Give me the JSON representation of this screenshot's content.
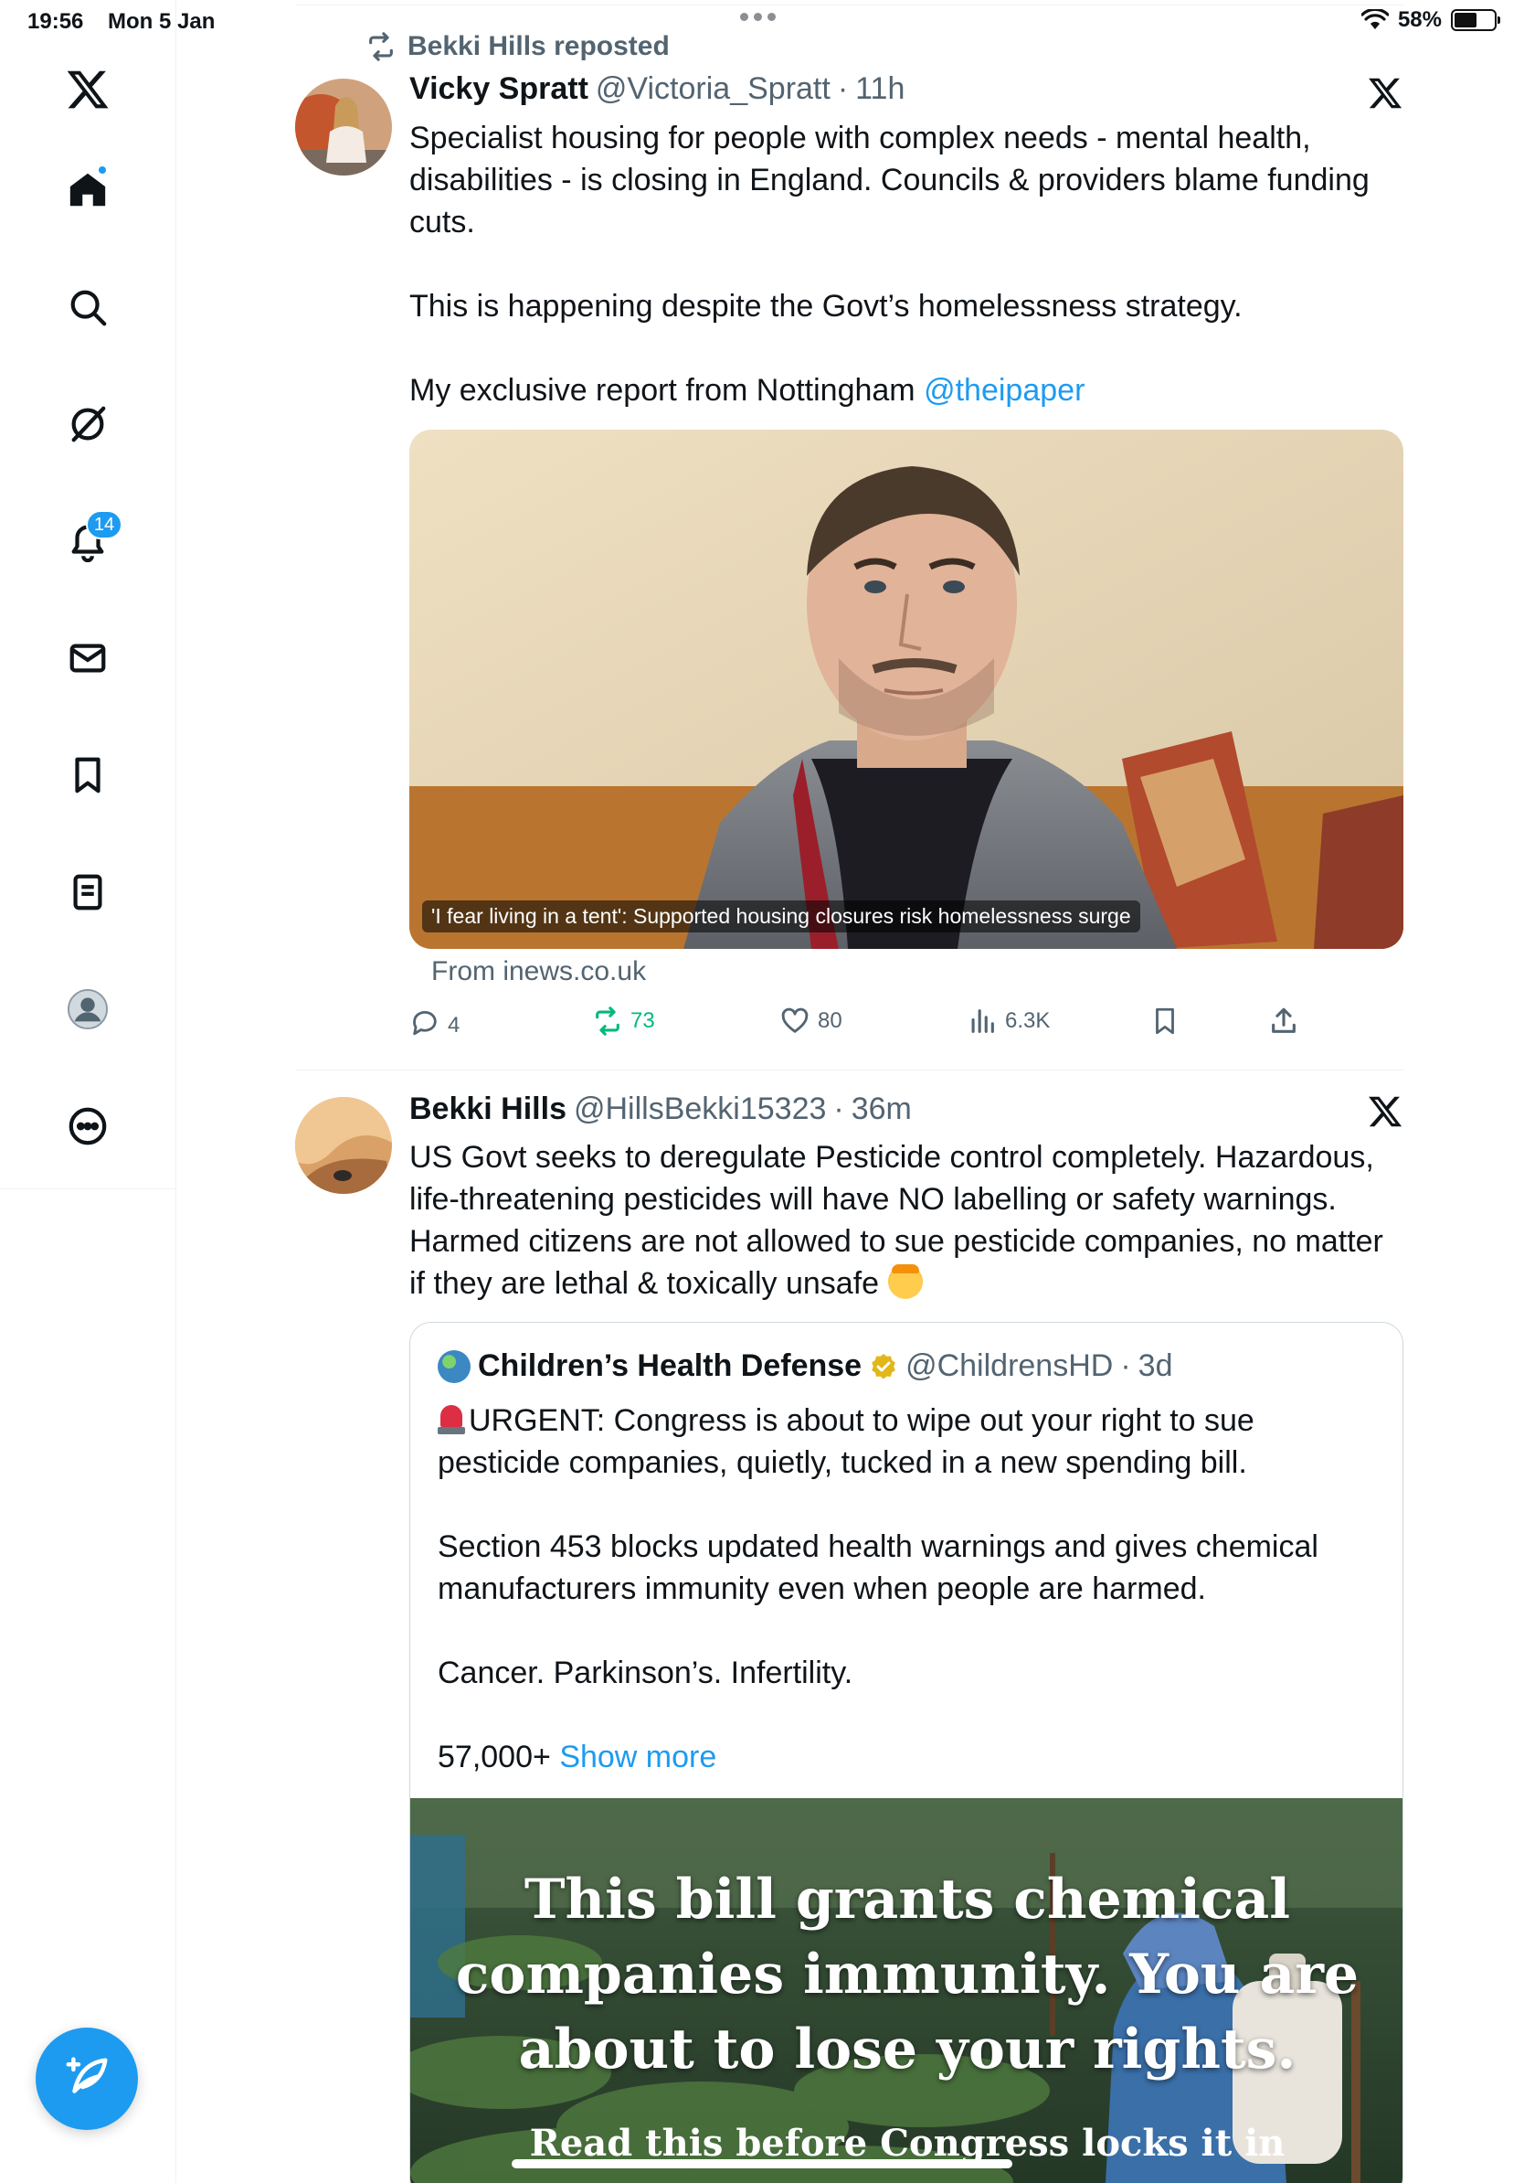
{
  "status_bar": {
    "time": "19:56",
    "date": "Mon 5 Jan",
    "battery": "58%",
    "battery_level": 0.58
  },
  "sidebar": {
    "notifications_count": "14",
    "items": [
      "x-logo",
      "home",
      "explore",
      "grok",
      "notifications",
      "messages",
      "bookmarks",
      "lists",
      "profile",
      "more"
    ]
  },
  "tweets": [
    {
      "repost_by": "Bekki Hills reposted",
      "name": "Vicky Spratt",
      "handle": "@Victoria_Spratt",
      "sep": "·",
      "time": "11h",
      "lines": [
        "Specialist housing for people with complex needs - mental health, disabilities - is closing in England. Councils & providers blame funding cuts.",
        "This is happening despite the Govt’s homelessness strategy.",
        "My exclusive report from Nottingham"
      ],
      "mention": "@theipaper",
      "card": {
        "caption": "'I fear living in a tent': Supported housing closures risk homelessness surge",
        "source": "From inews.co.uk"
      },
      "actions": {
        "replies": "4",
        "reposts": "73",
        "likes": "80",
        "views": "6.3K"
      }
    },
    {
      "name": "Bekki Hills",
      "handle": "@HillsBekki15323",
      "sep": "·",
      "time": "36m",
      "text": "US Govt seeks to deregulate Pesticide control completely. Hazardous, life-threatening pesticides will have NO labelling or safety warnings. Harmed citizens are not allowed to sue pesticide companies, no matter if they are lethal & toxically unsafe",
      "quote": {
        "name": "Children’s Health Defense",
        "handle": "@ChildrensHD",
        "sep": "·",
        "time": "3d",
        "line1": "URGENT: Congress is about to wipe out your right to sue pesticide companies, quietly, tucked in a new spending bill.",
        "line2": "Section 453 blocks updated health warnings and gives chemical manufacturers immunity even when people are harmed.",
        "line3": "Cancer. Parkinson’s. Infertility.",
        "line4": "57,000+",
        "show_more": "Show more",
        "media_text": [
          "This bill grants chemical",
          "companies immunity. You are",
          "about to lose your rights."
        ],
        "media_sub": "Read this before Congress locks it in"
      }
    }
  ]
}
